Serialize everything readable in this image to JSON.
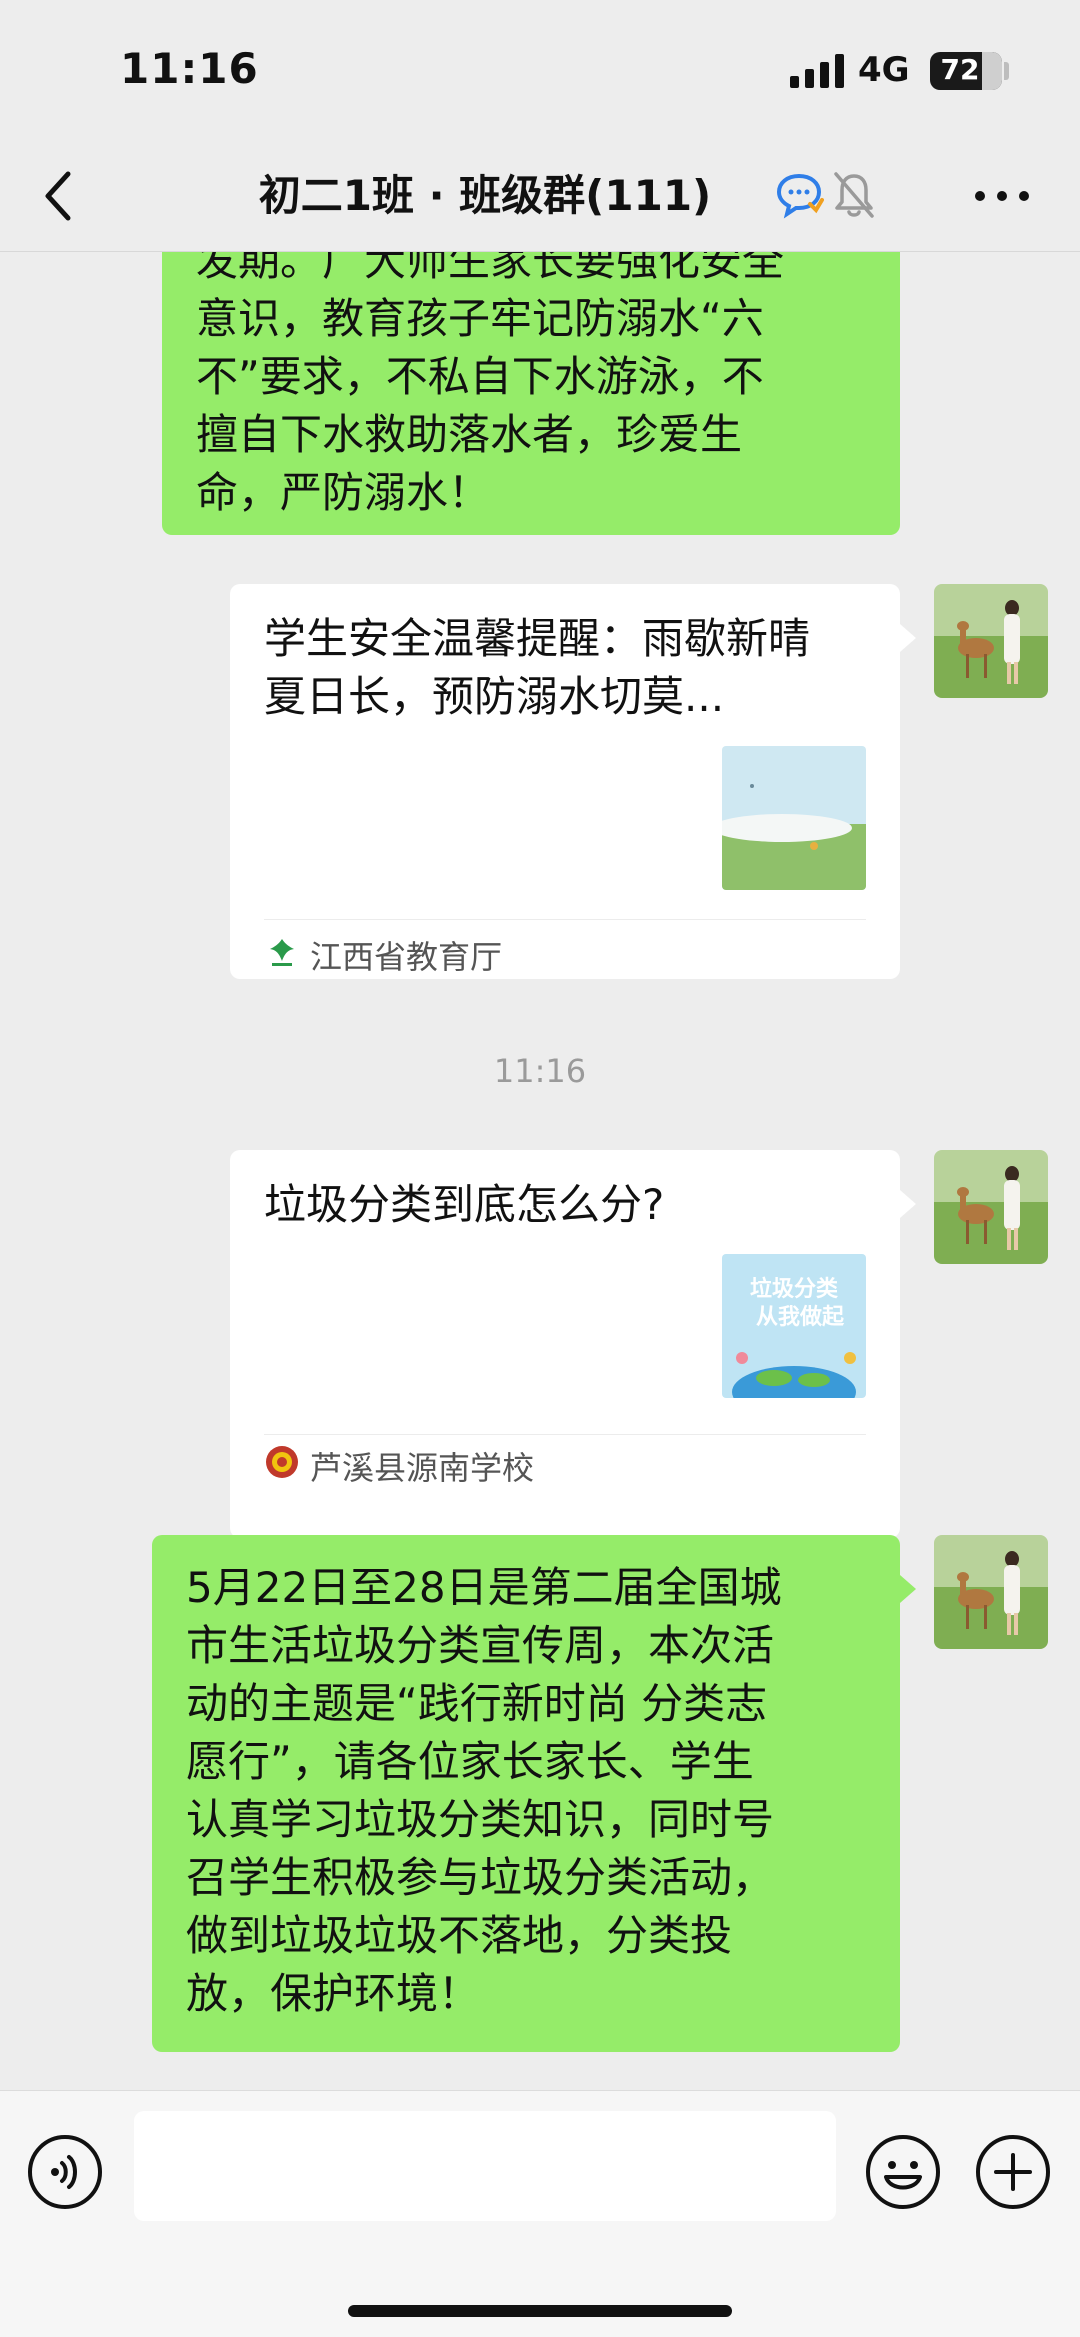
{
  "status_bar": {
    "time": "11:16",
    "network": "4G",
    "battery": "72",
    "battery_level": 0.72
  },
  "nav": {
    "title": "初二1班 · 班级群(111)",
    "back_icon": "chevron-left-icon",
    "chat_icon": "chat-bubble-icon",
    "mute_icon": "bell-slash-icon",
    "more_icon": "more-dots-icon"
  },
  "messages": [
    {
      "type": "text",
      "sender": "me",
      "lines": [
        "发期。广大师生家长要强化安全",
        "意识，教育孩子牢记防溺水“六",
        "不”要求，不私自下水游泳，不",
        "擅自下水救助落水者，珍爱生",
        "命，严防溺水！"
      ]
    },
    {
      "type": "article",
      "sender": "me",
      "title": "学生安全温馨提醒：雨歇新晴夏日长，预防溺水切莫...",
      "source": "江西省教育厅"
    },
    {
      "type": "time",
      "text": "11:16"
    },
    {
      "type": "article",
      "sender": "me",
      "title": "垃圾分类到底怎么分?",
      "source": "芦溪县源南学校",
      "thumb_lines": [
        "垃圾分类",
        "从我做起"
      ]
    },
    {
      "type": "text",
      "sender": "me",
      "lines": [
        "5月22日至28日是第二届全国城",
        "市生活垃圾分类宣传周，本次活",
        "动的主题是“践行新时尚 分类志",
        "愿行”，请各位家长家长、学生",
        "认真学习垃圾分类知识，同时号",
        "召学生积极参与垃圾分类活动，",
        "做到垃圾垃圾不落地，分类投",
        "放，保护环境！"
      ]
    }
  ],
  "input_bar": {
    "voice_icon": "voice-icon",
    "emoji_icon": "emoji-icon",
    "add_icon": "add-icon",
    "input_value": ""
  },
  "colors": {
    "bubble_green": "#95ec69",
    "background": "#ededed",
    "card": "#ffffff"
  }
}
